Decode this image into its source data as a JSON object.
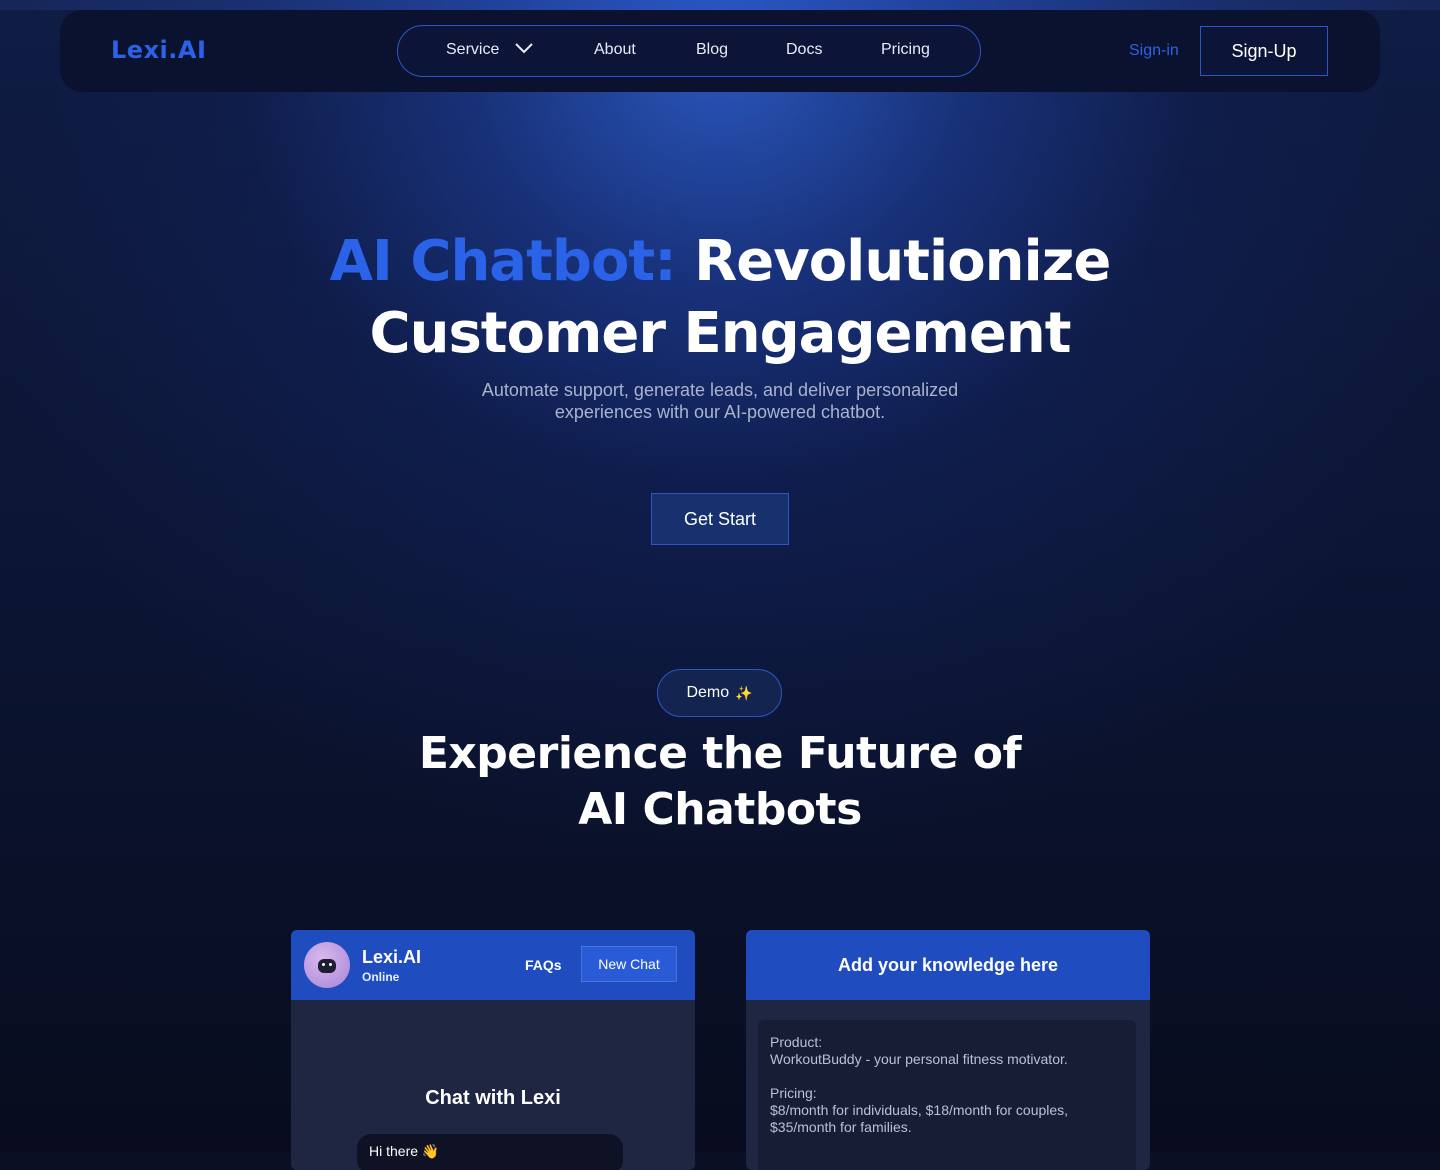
{
  "nav": {
    "logo": "Lexi.AI",
    "items": [
      {
        "label": "Service",
        "has_dropdown": true
      },
      {
        "label": "About"
      },
      {
        "label": "Blog"
      },
      {
        "label": "Docs"
      },
      {
        "label": "Pricing"
      }
    ],
    "sign_in": "Sign-in",
    "sign_up": "Sign-Up"
  },
  "hero": {
    "title_accent": "AI Chatbot:",
    "title_line1_rest": "Revolutionize",
    "title_line2": "Customer Engagement",
    "subtitle_line1": "Automate support, generate leads, and deliver personalized",
    "subtitle_line2": "experiences with our AI-powered chatbot.",
    "cta": "Get Start"
  },
  "demo": {
    "pill": "Demo",
    "pill_icon": "sparkles-icon",
    "title_line1": "Experience the Future of",
    "title_line2": "AI Chatbots"
  },
  "chat_card": {
    "bot_name": "Lexi.AI",
    "status": "Online",
    "faqs": "FAQs",
    "new_chat": "New Chat",
    "title": "Chat with Lexi",
    "bubble": "Hi there 👋"
  },
  "knowledge_card": {
    "title": "Add your knowledge here",
    "lines": [
      "Product:",
      "WorkoutBuddy - your personal fitness motivator.",
      "",
      "Pricing:",
      "$8/month for individuals, $18/month for couples,",
      "$35/month for families."
    ]
  },
  "colors": {
    "accent": "#2a63e8",
    "card_header": "#1f4dc0",
    "background": "#0a0f24"
  }
}
